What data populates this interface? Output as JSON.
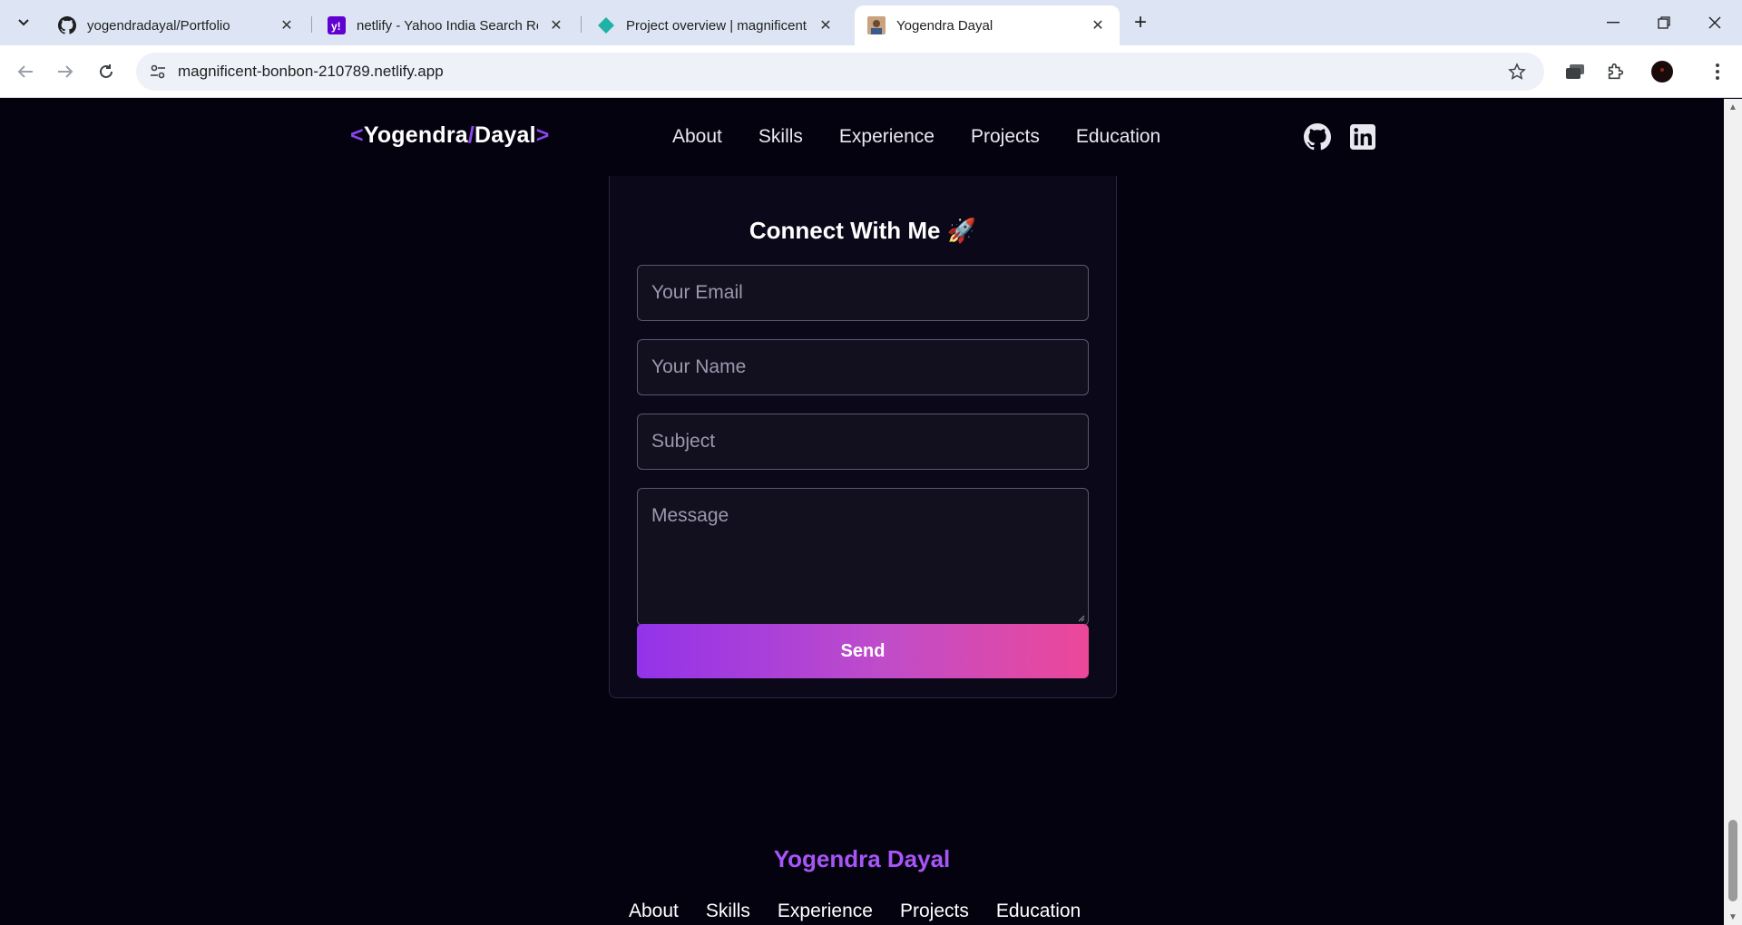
{
  "browser": {
    "tabs": [
      {
        "title": "yogendradayal/Portfolio",
        "favicon": "github-icon",
        "active": false
      },
      {
        "title": "netlify - Yahoo India Search Res",
        "favicon": "yahoo-icon",
        "active": false
      },
      {
        "title": "Project overview | magnificent-b",
        "favicon": "netlify-icon",
        "active": false
      },
      {
        "title": "Yogendra Dayal",
        "favicon": "profile-photo-icon",
        "active": true
      }
    ],
    "url": "magnificent-bonbon-210789.netlify.app",
    "colors": {
      "tabstrip": "#dde5f4",
      "omnibox": "#eef1f8"
    }
  },
  "site": {
    "logo": {
      "open": "<",
      "first": "Yogendra",
      "slash": "/",
      "last": "Dayal",
      "close": ">"
    },
    "nav": [
      "About",
      "Skills",
      "Experience",
      "Projects",
      "Education"
    ],
    "social": [
      "github-icon",
      "linkedin-icon"
    ],
    "contact": {
      "title": "Connect With Me 🚀",
      "email_placeholder": "Your Email",
      "name_placeholder": "Your Name",
      "subject_placeholder": "Subject",
      "message_placeholder": "Message",
      "send_label": "Send"
    },
    "footer": {
      "name": "Yogendra Dayal",
      "links": [
        "About",
        "Skills",
        "Experience",
        "Projects",
        "Education"
      ]
    },
    "colors": {
      "background": "#04020f",
      "accent": "#a855f7",
      "button_start": "#9333ea",
      "button_end": "#ec4899"
    }
  }
}
